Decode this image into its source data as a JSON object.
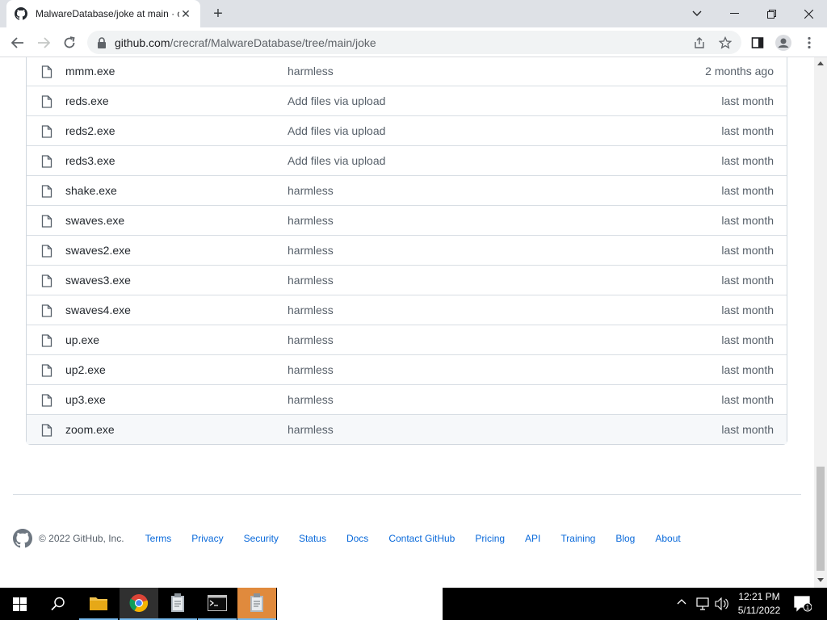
{
  "browser": {
    "tab_title": "MalwareDatabase/joke at main · crecraf/MalwareDatabase",
    "tab_close": "✕",
    "new_tab": "+",
    "url_host": "github.com",
    "url_path": "/crecraf/MalwareDatabase/tree/main/joke"
  },
  "files": [
    {
      "name": "mmm.exe",
      "message": "harmless",
      "age": "2 months ago"
    },
    {
      "name": "reds.exe",
      "message": "Add files via upload",
      "age": "last month"
    },
    {
      "name": "reds2.exe",
      "message": "Add files via upload",
      "age": "last month"
    },
    {
      "name": "reds3.exe",
      "message": "Add files via upload",
      "age": "last month"
    },
    {
      "name": "shake.exe",
      "message": "harmless",
      "age": "last month"
    },
    {
      "name": "swaves.exe",
      "message": "harmless",
      "age": "last month"
    },
    {
      "name": "swaves2.exe",
      "message": "harmless",
      "age": "last month"
    },
    {
      "name": "swaves3.exe",
      "message": "harmless",
      "age": "last month"
    },
    {
      "name": "swaves4.exe",
      "message": "harmless",
      "age": "last month"
    },
    {
      "name": "up.exe",
      "message": "harmless",
      "age": "last month"
    },
    {
      "name": "up2.exe",
      "message": "harmless",
      "age": "last month"
    },
    {
      "name": "up3.exe",
      "message": "harmless",
      "age": "last month"
    },
    {
      "name": "zoom.exe",
      "message": "harmless",
      "age": "last month"
    }
  ],
  "footer": {
    "copyright": "© 2022 GitHub, Inc.",
    "links": [
      "Terms",
      "Privacy",
      "Security",
      "Status",
      "Docs",
      "Contact GitHub",
      "Pricing",
      "API",
      "Training",
      "Blog",
      "About"
    ]
  },
  "taskbar": {
    "time": "12:21 PM",
    "date": "5/11/2022",
    "notification_count": "1"
  },
  "colors": {
    "link": "#0969da",
    "muted_text": "#57606a",
    "border": "#d0d7de",
    "taskbar_highlight": "#e08a3d"
  }
}
